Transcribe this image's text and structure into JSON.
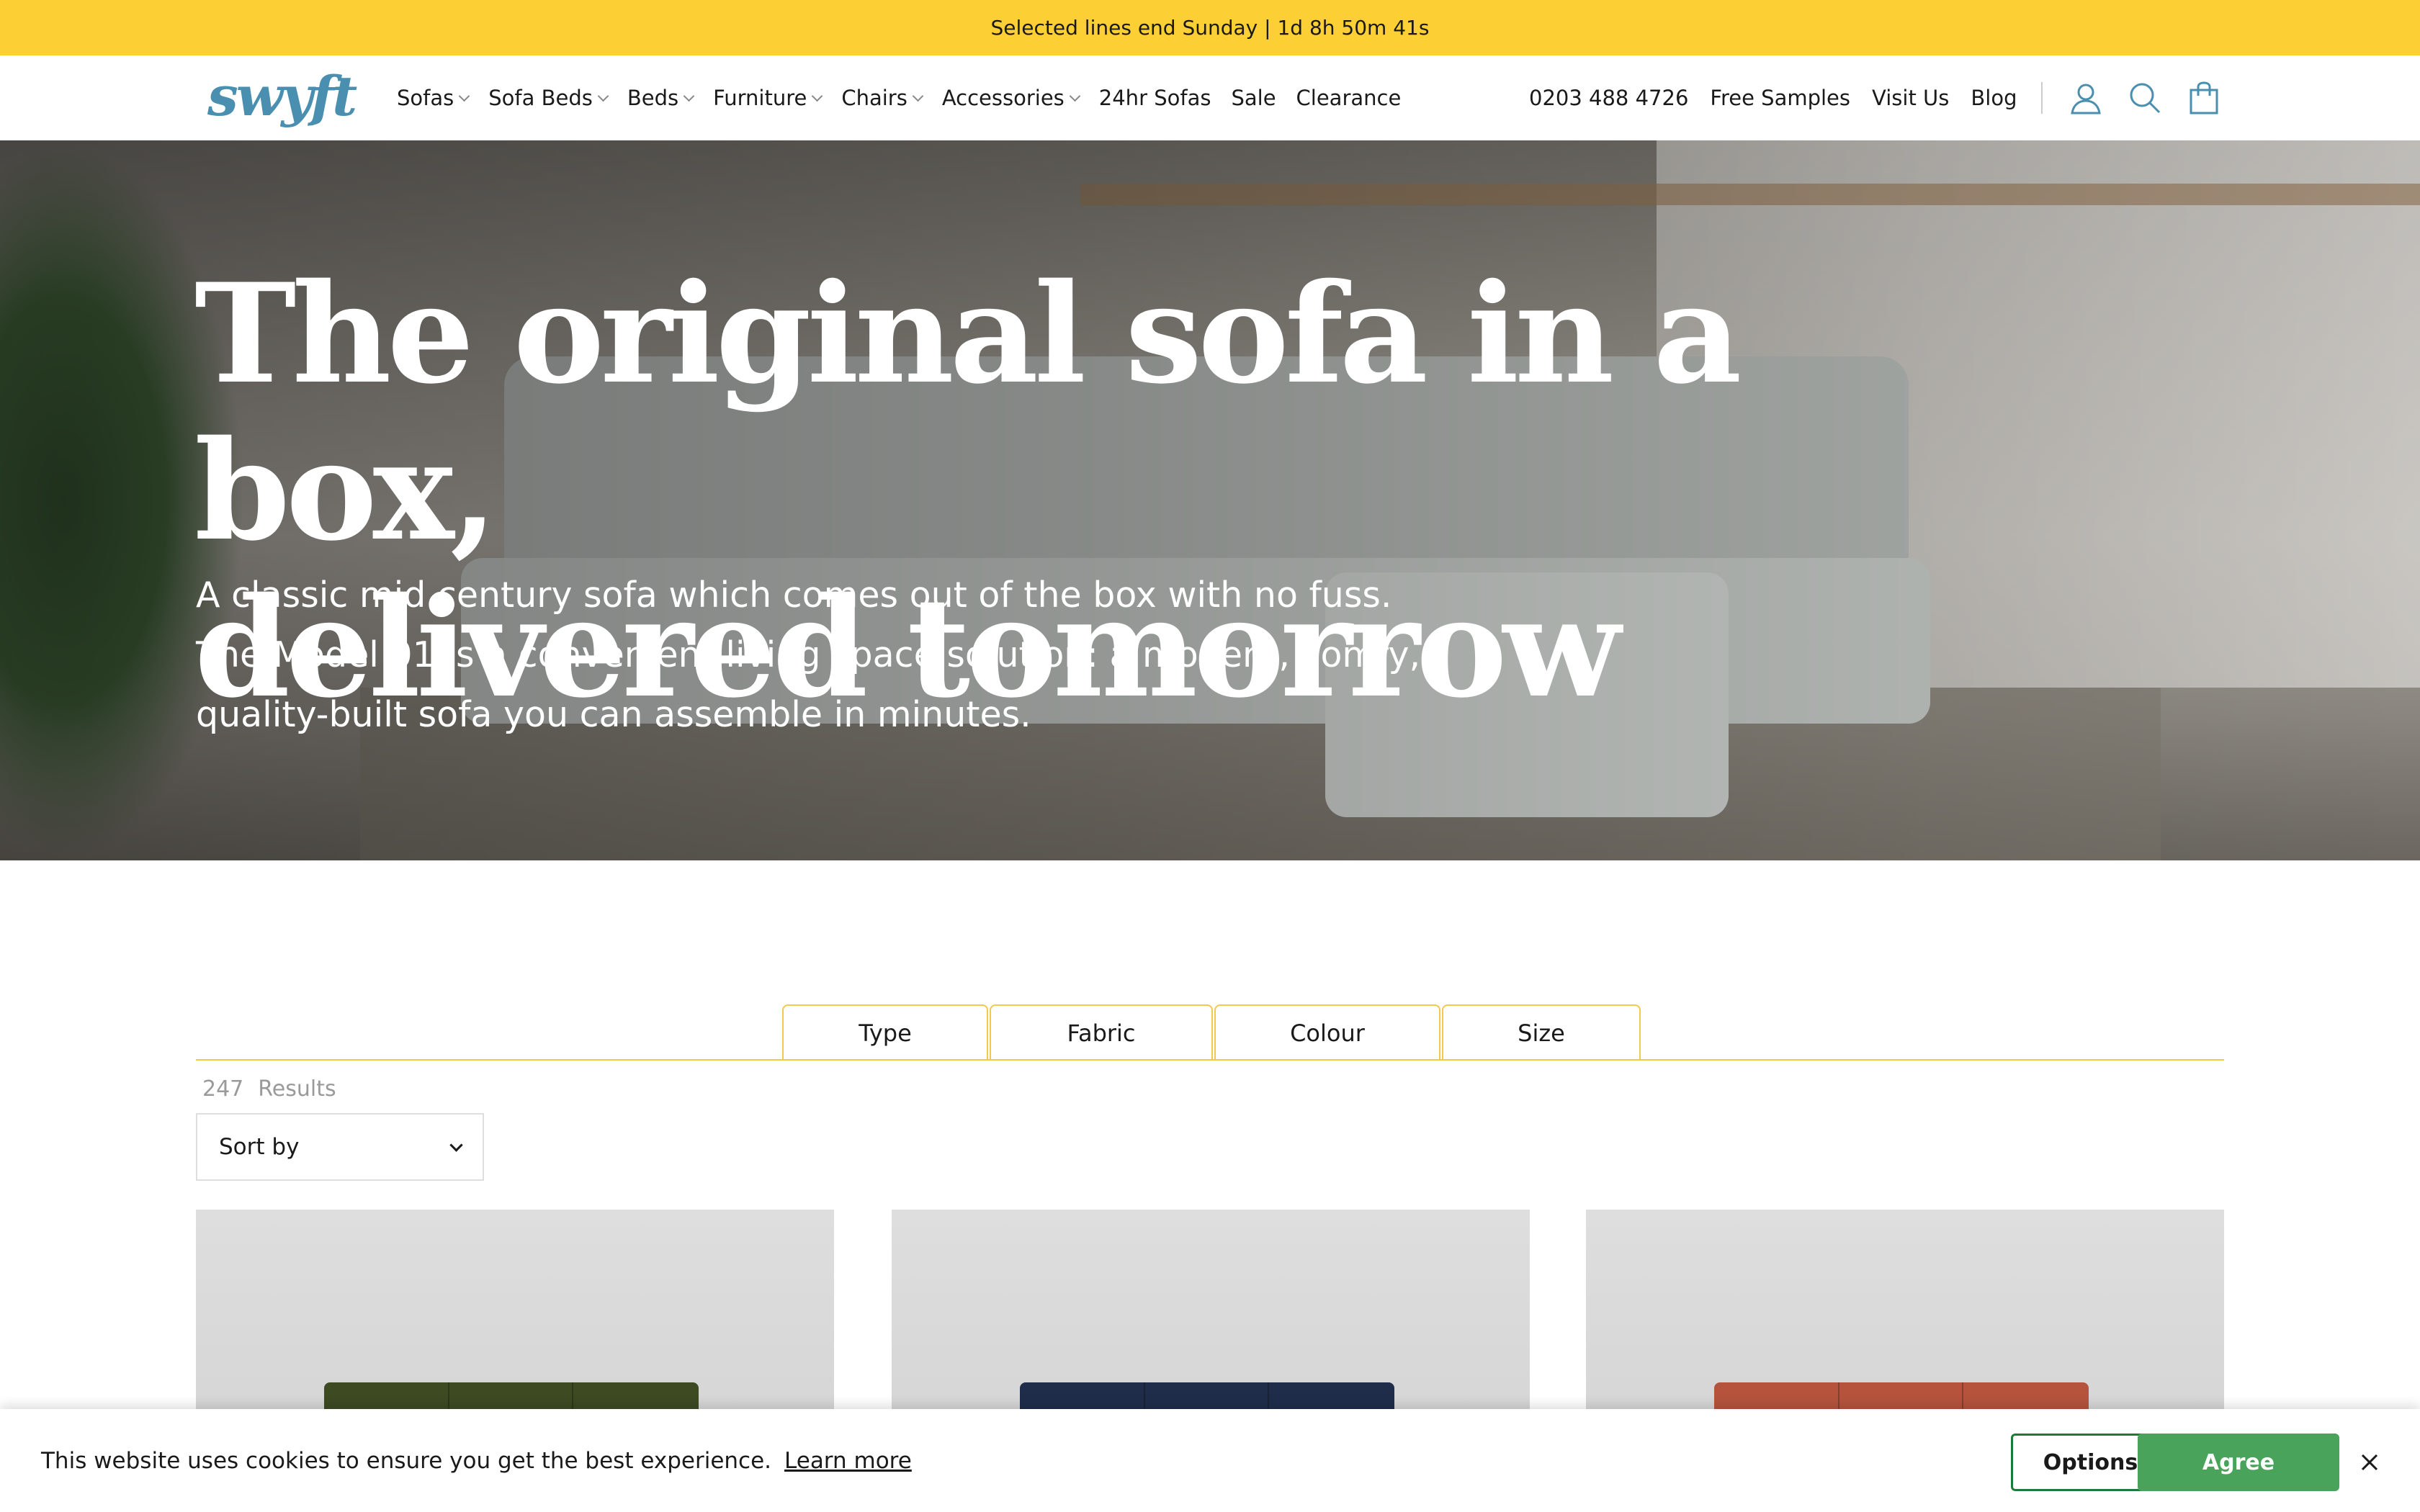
{
  "announcement": "Selected lines end Sunday | 1d 8h 50m 41s",
  "logo": "swyft",
  "nav": [
    {
      "label": "Sofas",
      "dropdown": true
    },
    {
      "label": "Sofa Beds",
      "dropdown": true
    },
    {
      "label": "Beds",
      "dropdown": true
    },
    {
      "label": "Furniture",
      "dropdown": true
    },
    {
      "label": "Chairs",
      "dropdown": true
    },
    {
      "label": "Accessories",
      "dropdown": true
    },
    {
      "label": "24hr Sofas",
      "dropdown": false
    },
    {
      "label": "Sale",
      "dropdown": false
    },
    {
      "label": "Clearance",
      "dropdown": false
    }
  ],
  "utility": {
    "phone": "0203 488 4726",
    "free_samples": "Free Samples",
    "visit_us": "Visit Us",
    "blog": "Blog",
    "icons": [
      "user-icon",
      "search-icon",
      "bag-icon"
    ]
  },
  "hero": {
    "title_line1": "The original sofa in a box,",
    "title_line2": "delivered tomorrow",
    "body_line1": "A classic mid century sofa which comes out of the box with no fuss.",
    "body_line2": "The Model 01 is a convenient living space solution: a modern, comfy,",
    "body_line3": "quality-built sofa you can assemble in minutes."
  },
  "filters": {
    "tabs": [
      "Type",
      "Fabric",
      "Colour",
      "Size"
    ],
    "results_count": "247",
    "results_label": "Results",
    "sort_label": "Sort by"
  },
  "products": [
    {
      "color_name": "green",
      "color": "#3d4a22"
    },
    {
      "color_name": "navy",
      "color": "#1f2d4a"
    },
    {
      "color_name": "terracotta",
      "color": "#b5533d"
    }
  ],
  "cookie": {
    "text": "This website uses cookies to ensure you get the best experience.",
    "learn_more": "Learn more",
    "options": "Options",
    "agree": "Agree"
  },
  "colors": {
    "announcement_bg": "#fcd035",
    "accent_yellow": "#f2c94c",
    "logo": "#4a8fb0",
    "agree_green": "#4aa35a"
  }
}
